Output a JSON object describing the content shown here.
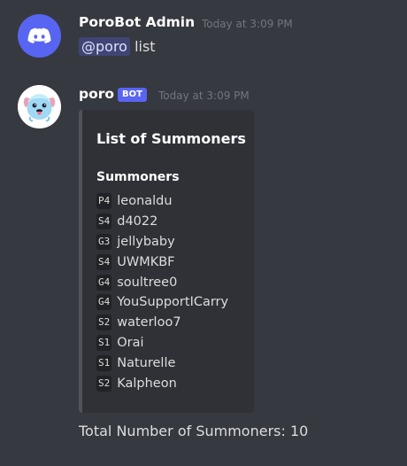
{
  "message1": {
    "username": "PoroBot Admin",
    "timestamp": "Today at 3:09 PM",
    "mention": "@poro",
    "text": "list",
    "avatar_icon": "discord-logo-icon",
    "avatar_color": "#5865f2"
  },
  "message2": {
    "username": "poro",
    "badge": "BOT",
    "timestamp": "Today at 3:09 PM",
    "avatar_icon": "poro-mascot-icon",
    "embed": {
      "title": "List of Summoners",
      "field_name": "Summoners",
      "summoners": [
        {
          "rank": "P4",
          "name": "leonaldu"
        },
        {
          "rank": "S4",
          "name": "d4022"
        },
        {
          "rank": "G3",
          "name": "jellybaby"
        },
        {
          "rank": "S4",
          "name": "UWMKBF"
        },
        {
          "rank": "G4",
          "name": "soultree0"
        },
        {
          "rank": "G4",
          "name": "YouSupportICarry"
        },
        {
          "rank": "S2",
          "name": "waterloo7"
        },
        {
          "rank": "S1",
          "name": "Orai"
        },
        {
          "rank": "S1",
          "name": "Naturelle"
        },
        {
          "rank": "S2",
          "name": "Kalpheon"
        }
      ]
    },
    "footer_text": "Total Number of Summoners: 10"
  },
  "colors": {
    "background": "#36393f",
    "embed_bg": "#2f3136",
    "accent": "#5865f2",
    "timestamp": "#72767d"
  }
}
